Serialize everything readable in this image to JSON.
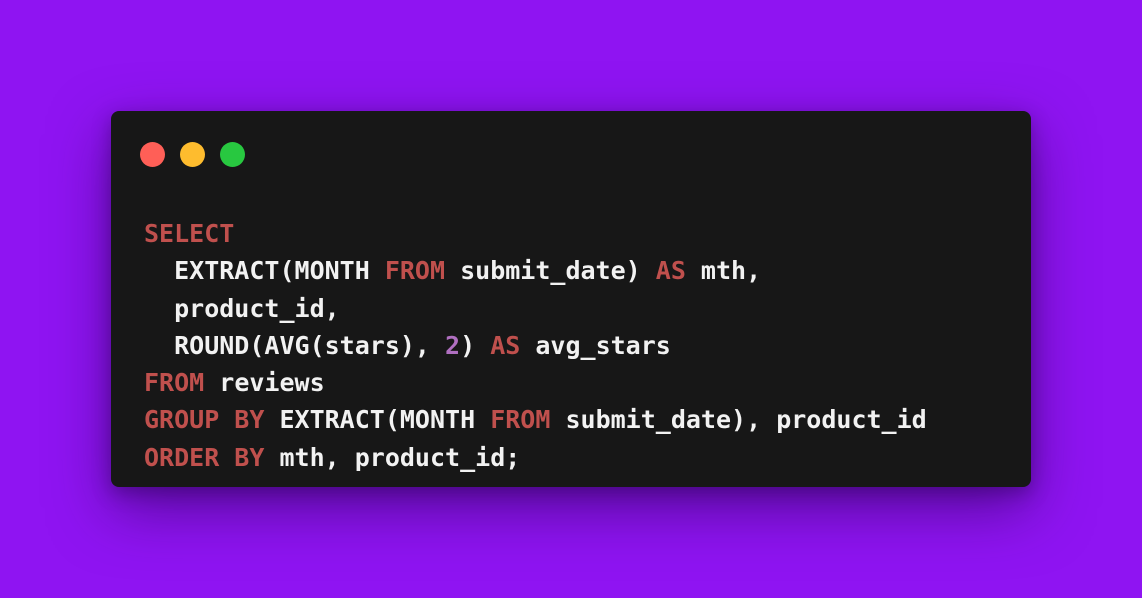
{
  "colors": {
    "background": "#8f14f2",
    "window": "#171717",
    "keyword": "#c0504d",
    "number": "#b06fc0",
    "text": "#f2f2f2"
  },
  "window_controls": [
    {
      "name": "close-dot",
      "color": "#ff5f57"
    },
    {
      "name": "minimize-dot",
      "color": "#febc2e"
    },
    {
      "name": "zoom-dot",
      "color": "#28c840"
    }
  ],
  "code_lines": [
    [
      {
        "t": "SELECT",
        "k": "kw"
      }
    ],
    [
      {
        "t": "  EXTRACT(MONTH ",
        "k": "plain"
      },
      {
        "t": "FROM",
        "k": "kw"
      },
      {
        "t": " submit_date) ",
        "k": "plain"
      },
      {
        "t": "AS",
        "k": "kw"
      },
      {
        "t": " mth,",
        "k": "plain"
      }
    ],
    [
      {
        "t": "  product_id,",
        "k": "plain"
      }
    ],
    [
      {
        "t": "  ROUND(AVG(stars), ",
        "k": "plain"
      },
      {
        "t": "2",
        "k": "num"
      },
      {
        "t": ") ",
        "k": "plain"
      },
      {
        "t": "AS",
        "k": "kw"
      },
      {
        "t": " avg_stars",
        "k": "plain"
      }
    ],
    [
      {
        "t": "FROM",
        "k": "kw"
      },
      {
        "t": " reviews",
        "k": "plain"
      }
    ],
    [
      {
        "t": "GROUP BY",
        "k": "kw"
      },
      {
        "t": " EXTRACT(MONTH ",
        "k": "plain"
      },
      {
        "t": "FROM",
        "k": "kw"
      },
      {
        "t": " submit_date), product_id",
        "k": "plain"
      }
    ],
    [
      {
        "t": "ORDER BY",
        "k": "kw"
      },
      {
        "t": " mth, product_id;",
        "k": "plain"
      }
    ]
  ]
}
